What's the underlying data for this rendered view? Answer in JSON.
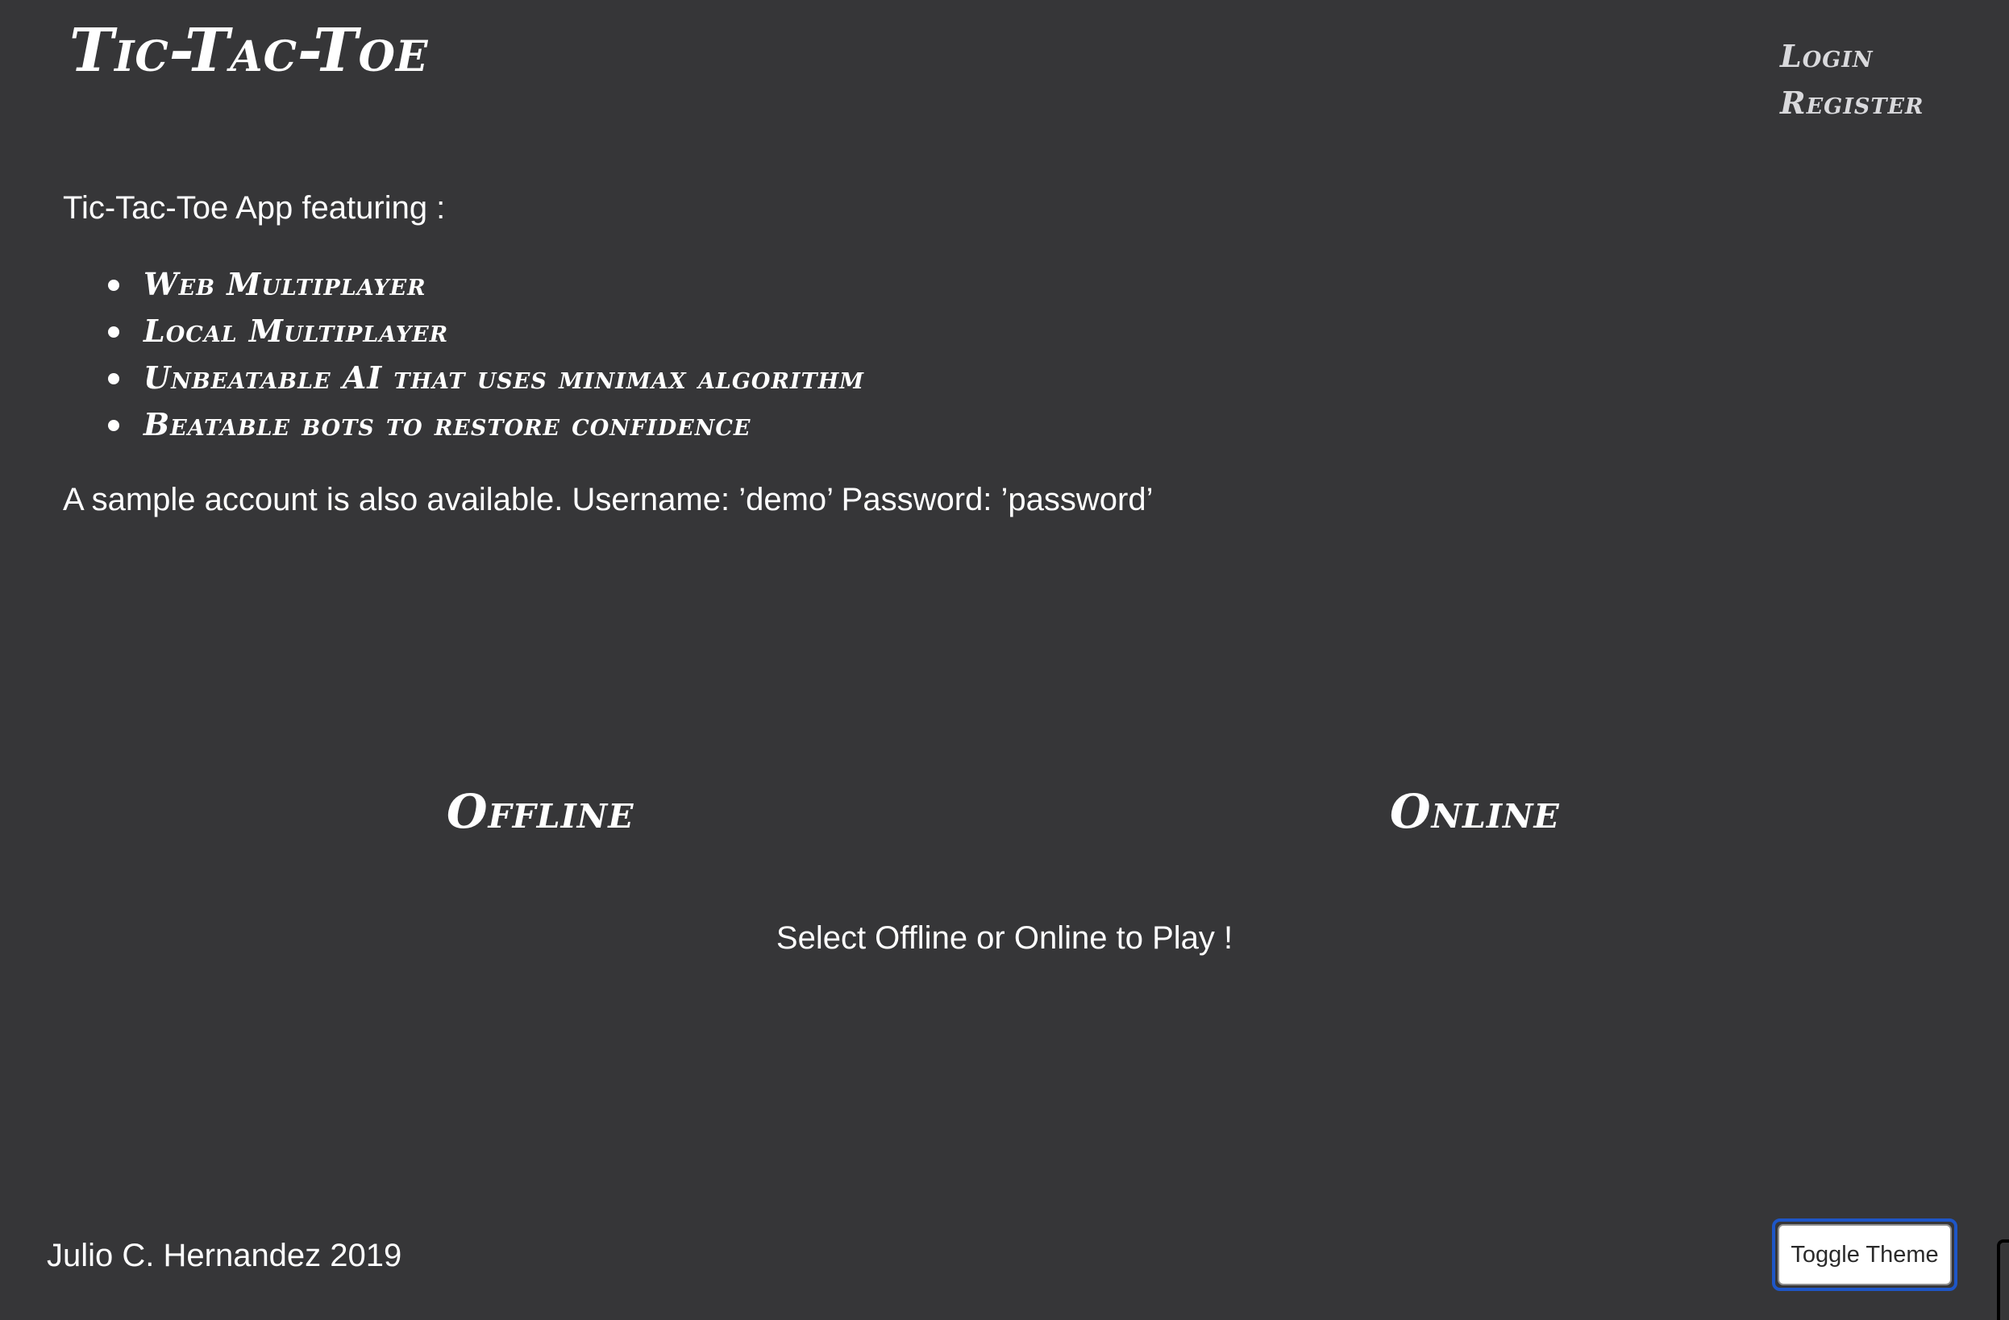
{
  "header": {
    "title": "Tic-Tac-Toe",
    "nav": {
      "login_label": "Login",
      "register_label": "Register"
    }
  },
  "main": {
    "intro": "Tic-Tac-Toe App featuring :",
    "features": [
      "Web Multiplayer",
      "Local Multiplayer",
      "Unbeatable AI that uses minimax algorithm",
      "Beatable bots to restore confidence"
    ],
    "sample_account": "A sample account is also available. Username: ’demo’ Password: ’password’",
    "modes": {
      "offline_label": "Offline",
      "online_label": "Online"
    },
    "prompt": "Select Offline or Online to Play !"
  },
  "footer": {
    "credit": "Julio C. Hernandez 2019",
    "toggle_theme_label": "Toggle Theme"
  },
  "colors": {
    "background": "#363638",
    "text": "#ffffff",
    "nav_text": "#d9d9dc",
    "focus_ring": "#1e56c7"
  }
}
